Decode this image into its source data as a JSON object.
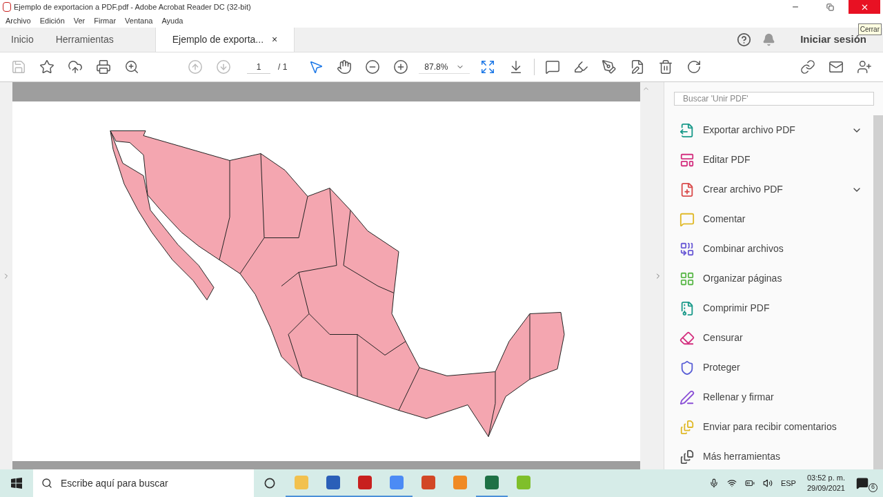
{
  "window": {
    "title": "Ejemplo de exportacion a PDF.pdf - Adobe Acrobat Reader DC (32-bit)",
    "tooltip": "Cerrar"
  },
  "menu": [
    "Archivo",
    "Edición",
    "Ver",
    "Firmar",
    "Ventana",
    "Ayuda"
  ],
  "tabs": [
    {
      "label": "Inicio",
      "selected": false,
      "closable": false
    },
    {
      "label": "Herramientas",
      "selected": false,
      "closable": false
    },
    {
      "label": "Ejemplo de exporta...",
      "selected": true,
      "closable": true
    }
  ],
  "close_tab": "×",
  "sign_in": "Iniciar sesión",
  "toolbar": {
    "page": "1",
    "page_total": "/ 1",
    "zoom": "87.8%"
  },
  "tools_panel": {
    "search": {
      "placeholder": "Buscar 'Unir PDF'"
    },
    "items": [
      {
        "label": "Exportar archivo PDF",
        "color": "#1a9a8a",
        "expandable": true
      },
      {
        "label": "Editar PDF",
        "color": "#d4307f",
        "expandable": false
      },
      {
        "label": "Crear archivo PDF",
        "color": "#d94c4c",
        "expandable": true
      },
      {
        "label": "Comentar",
        "color": "#e0b928",
        "expandable": false
      },
      {
        "label": "Combinar archivos",
        "color": "#6b5bd6",
        "expandable": false
      },
      {
        "label": "Organizar páginas",
        "color": "#5bb84a",
        "expandable": false
      },
      {
        "label": "Comprimir PDF",
        "color": "#1a9a8a",
        "expandable": false
      },
      {
        "label": "Censurar",
        "color": "#d4307f",
        "expandable": false
      },
      {
        "label": "Proteger",
        "color": "#5a5fd6",
        "expandable": false
      },
      {
        "label": "Rellenar y firmar",
        "color": "#8a4fd6",
        "expandable": false
      },
      {
        "label": "Enviar para recibir comentarios",
        "color": "#e0b928",
        "expandable": false
      },
      {
        "label": "Más herramientas",
        "color": "#555555",
        "expandable": false
      }
    ]
  },
  "taskbar": {
    "search": {
      "placeholder": "Escribe aquí para buscar"
    },
    "apps": [
      {
        "color": "#f2c14e",
        "active": true
      },
      {
        "color": "#2b5fb8",
        "active": true
      },
      {
        "color": "#c8201e",
        "active": true
      },
      {
        "color": "#4c8bf5",
        "active": true
      },
      {
        "color": "#d24726",
        "active": false
      },
      {
        "color": "#f08a24",
        "active": false
      },
      {
        "color": "#1e7145",
        "active": true
      },
      {
        "color": "#7fbf2a",
        "active": false
      }
    ],
    "language": "ESP",
    "time": "03:52 p. m.",
    "date": "29/09/2021",
    "notifications": "6"
  }
}
